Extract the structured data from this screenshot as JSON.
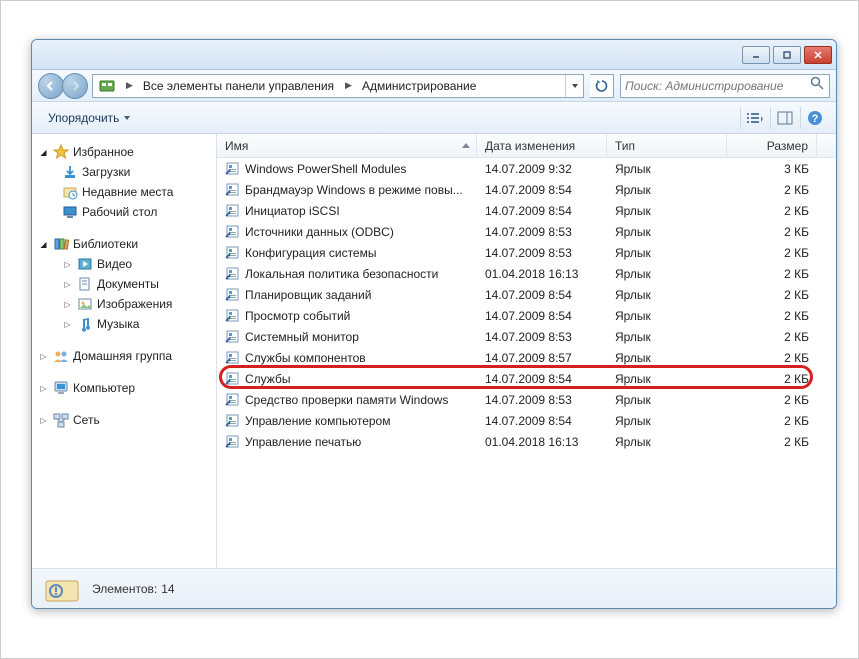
{
  "titlebar": {},
  "address": {
    "icon": "control-panel",
    "seg1": "Все элементы панели управления",
    "seg2": "Администрирование"
  },
  "search": {
    "placeholder": "Поиск: Администрирование"
  },
  "toolbar": {
    "organize": "Упорядочить"
  },
  "navpane": {
    "favorites": {
      "label": "Избранное",
      "items": [
        {
          "icon": "download",
          "label": "Загрузки"
        },
        {
          "icon": "recent",
          "label": "Недавние места"
        },
        {
          "icon": "desktop",
          "label": "Рабочий стол"
        }
      ]
    },
    "libraries": {
      "label": "Библиотеки",
      "items": [
        {
          "icon": "video",
          "label": "Видео"
        },
        {
          "icon": "docs",
          "label": "Документы"
        },
        {
          "icon": "images",
          "label": "Изображения"
        },
        {
          "icon": "music",
          "label": "Музыка"
        }
      ]
    },
    "homegroup": {
      "label": "Домашняя группа"
    },
    "computer": {
      "label": "Компьютер"
    },
    "network": {
      "label": "Сеть"
    }
  },
  "columns": {
    "name": "Имя",
    "date": "Дата изменения",
    "type": "Тип",
    "size": "Размер"
  },
  "type_label": "Ярлык",
  "files": [
    {
      "name": "Windows PowerShell Modules",
      "date": "14.07.2009 9:32",
      "size": "3 КБ"
    },
    {
      "name": "Брандмауэр Windows в режиме повы...",
      "date": "14.07.2009 8:54",
      "size": "2 КБ"
    },
    {
      "name": "Инициатор iSCSI",
      "date": "14.07.2009 8:54",
      "size": "2 КБ"
    },
    {
      "name": "Источники данных (ODBC)",
      "date": "14.07.2009 8:53",
      "size": "2 КБ"
    },
    {
      "name": "Конфигурация системы",
      "date": "14.07.2009 8:53",
      "size": "2 КБ"
    },
    {
      "name": "Локальная политика безопасности",
      "date": "01.04.2018 16:13",
      "size": "2 КБ"
    },
    {
      "name": "Планировщик заданий",
      "date": "14.07.2009 8:54",
      "size": "2 КБ"
    },
    {
      "name": "Просмотр событий",
      "date": "14.07.2009 8:54",
      "size": "2 КБ"
    },
    {
      "name": "Системный монитор",
      "date": "14.07.2009 8:53",
      "size": "2 КБ"
    },
    {
      "name": "Службы компонентов",
      "date": "14.07.2009 8:57",
      "size": "2 КБ"
    },
    {
      "name": "Службы",
      "date": "14.07.2009 8:54",
      "size": "2 КБ",
      "highlight": true
    },
    {
      "name": "Средство проверки памяти Windows",
      "date": "14.07.2009 8:53",
      "size": "2 КБ"
    },
    {
      "name": "Управление компьютером",
      "date": "14.07.2009 8:54",
      "size": "2 КБ"
    },
    {
      "name": "Управление печатью",
      "date": "01.04.2018 16:13",
      "size": "2 КБ"
    }
  ],
  "status": {
    "count_label": "Элементов:",
    "count": "14"
  }
}
